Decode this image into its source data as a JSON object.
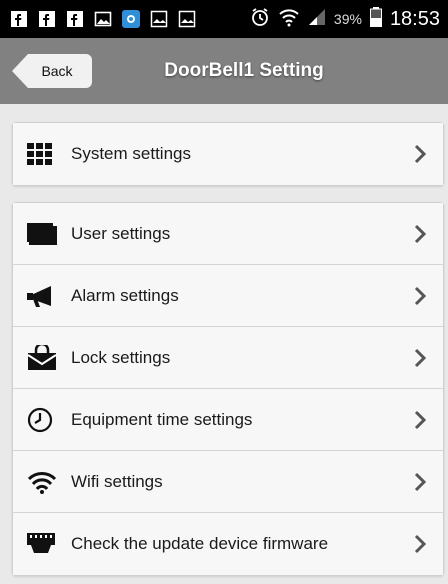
{
  "status_bar": {
    "battery_percent": "39%",
    "time": "18:53",
    "icons": [
      "facebook-icon",
      "facebook-icon",
      "facebook-icon",
      "image-icon",
      "app-icon",
      "picture-icon",
      "picture-icon",
      "alarm-icon",
      "wifi-icon",
      "signal-icon",
      "battery-icon"
    ]
  },
  "header": {
    "back_label": "Back",
    "title": "DoorBell1  Setting"
  },
  "settings": {
    "system": {
      "label": "System settings",
      "icon": "grid-icon"
    },
    "items": [
      {
        "label": "User settings",
        "icon": "user-card-icon"
      },
      {
        "label": "Alarm settings",
        "icon": "megaphone-icon"
      },
      {
        "label": "Lock settings",
        "icon": "lock-box-icon"
      },
      {
        "label": "Equipment time settings",
        "icon": "clock-icon"
      },
      {
        "label": "Wifi settings",
        "icon": "wifi-icon"
      },
      {
        "label": "Check the update device firmware",
        "icon": "chip-icon"
      }
    ]
  },
  "colors": {
    "status_bar_bg": "#000000",
    "title_bar_bg": "#818181",
    "page_bg": "#e9e9e9",
    "row_bg": "#f7f7f7"
  }
}
